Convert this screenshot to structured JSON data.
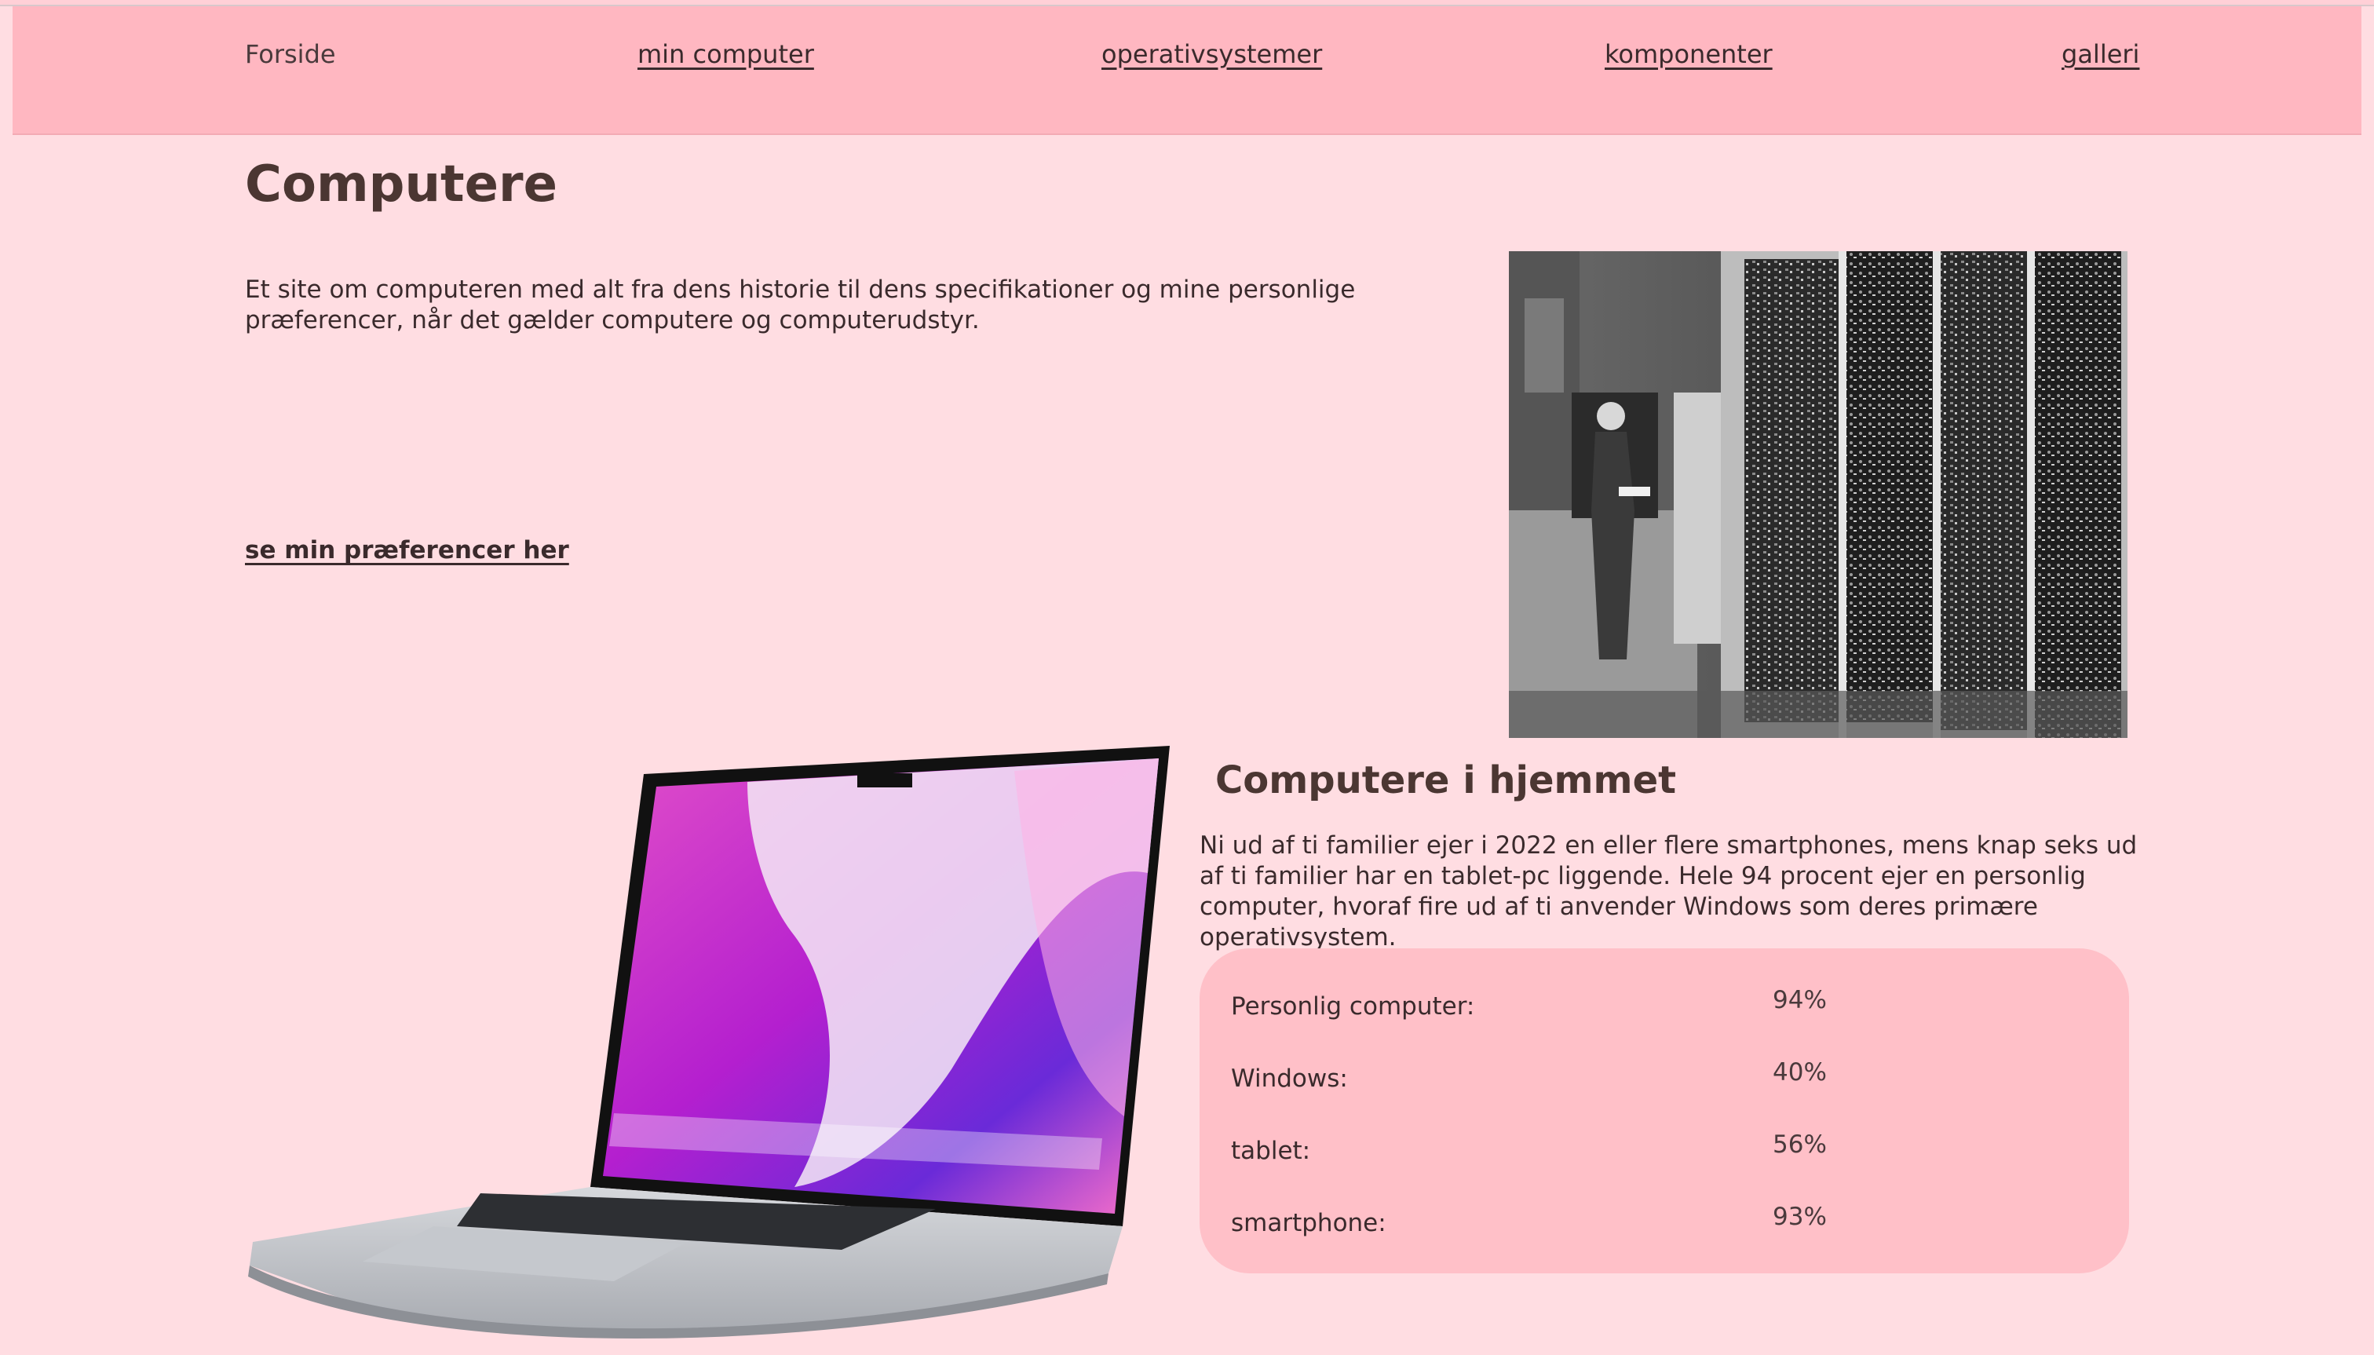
{
  "nav": {
    "home": "Forside",
    "links": [
      "min computer",
      "operativsystemer",
      "komponenter",
      "galleri"
    ]
  },
  "main": {
    "title": "Computere",
    "intro": "Et site om computeren med alt fra dens historie til dens specifikationer og mine personlige præferencer, når det gælder computere og computerudstyr.",
    "pref_link": "se min præferencer her"
  },
  "home_section": {
    "title": "Computere i hjemmet",
    "text": "Ni ud af ti familier ejer i 2022 en eller flere smartphones, mens knap seks ud af ti familier har en tablet-pc liggende. Hele 94 procent ejer en personlig computer, hvoraf fire ud af ti anvender Windows som deres primære operativsystem.",
    "stats": [
      {
        "label": "Personlig computer:",
        "value": "94%"
      },
      {
        "label": "Windows:",
        "value": "40%"
      },
      {
        "label": "tablet:",
        "value": "56%"
      },
      {
        "label": "smartphone:",
        "value": "93%"
      }
    ]
  },
  "colors": {
    "background": "#ffdde2",
    "nav": "#ffb7c1",
    "stats_box": "#ffc0c8",
    "heading": "#4b3632"
  }
}
